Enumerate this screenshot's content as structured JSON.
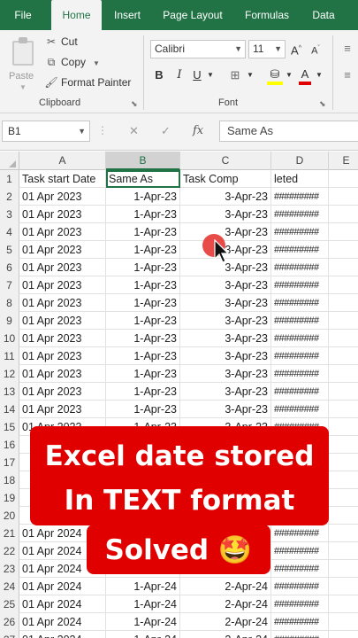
{
  "ribbon": {
    "tabs": [
      {
        "label": "File",
        "active": false
      },
      {
        "label": "Home",
        "active": true
      },
      {
        "label": "Insert",
        "active": false
      },
      {
        "label": "Page Layout",
        "active": false
      },
      {
        "label": "Formulas",
        "active": false
      },
      {
        "label": "Data",
        "active": false
      }
    ],
    "clipboard": {
      "paste_label": "Paste",
      "cut_label": "Cut",
      "copy_label": "Copy",
      "format_painter_label": "Format Painter",
      "group_label": "Clipboard"
    },
    "font": {
      "family": "Calibri",
      "size": "11",
      "grow_label": "A",
      "shrink_label": "A",
      "bold_label": "B",
      "italic_label": "I",
      "underline_label": "U",
      "font_color_label": "A",
      "group_label": "Font"
    }
  },
  "formula_bar": {
    "name_box": "B1",
    "fx_label": "fx",
    "formula": "Same As"
  },
  "grid": {
    "columns": [
      "A",
      "B",
      "C",
      "D",
      "E"
    ],
    "selected_column": "B",
    "header_row": {
      "num": "1",
      "a": "Task start Date",
      "b": "Same As",
      "c": "Task Comp",
      "d": "leted"
    },
    "rows": [
      {
        "num": "2",
        "a": "01 Apr 2023",
        "b": "1-Apr-23",
        "c": "3-Apr-23",
        "d": "#########"
      },
      {
        "num": "3",
        "a": "01 Apr 2023",
        "b": "1-Apr-23",
        "c": "3-Apr-23",
        "d": "#########"
      },
      {
        "num": "4",
        "a": "01 Apr 2023",
        "b": "1-Apr-23",
        "c": "3-Apr-23",
        "d": "#########"
      },
      {
        "num": "5",
        "a": "01 Apr 2023",
        "b": "1-Apr-23",
        "c": "3-Apr-23",
        "d": "#########"
      },
      {
        "num": "6",
        "a": "01 Apr 2023",
        "b": "1-Apr-23",
        "c": "3-Apr-23",
        "d": "#########"
      },
      {
        "num": "7",
        "a": "01 Apr 2023",
        "b": "1-Apr-23",
        "c": "3-Apr-23",
        "d": "#########"
      },
      {
        "num": "8",
        "a": "01 Apr 2023",
        "b": "1-Apr-23",
        "c": "3-Apr-23",
        "d": "#########"
      },
      {
        "num": "9",
        "a": "01 Apr 2023",
        "b": "1-Apr-23",
        "c": "3-Apr-23",
        "d": "#########"
      },
      {
        "num": "10",
        "a": "01 Apr 2023",
        "b": "1-Apr-23",
        "c": "3-Apr-23",
        "d": "#########"
      },
      {
        "num": "11",
        "a": "01 Apr 2023",
        "b": "1-Apr-23",
        "c": "3-Apr-23",
        "d": "#########"
      },
      {
        "num": "12",
        "a": "01 Apr 2023",
        "b": "1-Apr-23",
        "c": "3-Apr-23",
        "d": "#########"
      },
      {
        "num": "13",
        "a": "01 Apr 2023",
        "b": "1-Apr-23",
        "c": "3-Apr-23",
        "d": "#########"
      },
      {
        "num": "14",
        "a": "01 Apr 2023",
        "b": "1-Apr-23",
        "c": "3-Apr-23",
        "d": "#########"
      },
      {
        "num": "15",
        "a": "01 Apr 2023",
        "b": "1-Apr-23",
        "c": "3-Apr-23",
        "d": "#########"
      },
      {
        "num": "16",
        "a": "",
        "b": "",
        "c": "",
        "d": "#########"
      },
      {
        "num": "17",
        "a": "",
        "b": "",
        "c": "",
        "d": "#########"
      },
      {
        "num": "18",
        "a": "",
        "b": "",
        "c": "",
        "d": "#########"
      },
      {
        "num": "19",
        "a": "",
        "b": "",
        "c": "",
        "d": "#########"
      },
      {
        "num": "20",
        "a": "",
        "b": "",
        "c": "",
        "d": "#########"
      },
      {
        "num": "21",
        "a": "01 Apr 2024",
        "b": "",
        "c": "",
        "d": "#########"
      },
      {
        "num": "22",
        "a": "01 Apr 2024",
        "b": "",
        "c": "",
        "d": "#########"
      },
      {
        "num": "23",
        "a": "01 Apr 2024",
        "b": "",
        "c": "",
        "d": "#########"
      },
      {
        "num": "24",
        "a": "01 Apr 2024",
        "b": "1-Apr-24",
        "c": "2-Apr-24",
        "d": "#########"
      },
      {
        "num": "25",
        "a": "01 Apr 2024",
        "b": "1-Apr-24",
        "c": "2-Apr-24",
        "d": "#########"
      },
      {
        "num": "26",
        "a": "01 Apr 2024",
        "b": "1-Apr-24",
        "c": "2-Apr-24",
        "d": "#########"
      },
      {
        "num": "27",
        "a": "01 Apr 2024",
        "b": "1-Apr-24",
        "c": "2-Apr-24",
        "d": "#########"
      }
    ]
  },
  "overlay": {
    "line1": "Excel date stored",
    "line2": "In TEXT format",
    "line3": "Solved 🤩"
  },
  "colors": {
    "excel_green": "#217346",
    "banner_red": "#e00000",
    "cursor_red": "#e53935"
  }
}
